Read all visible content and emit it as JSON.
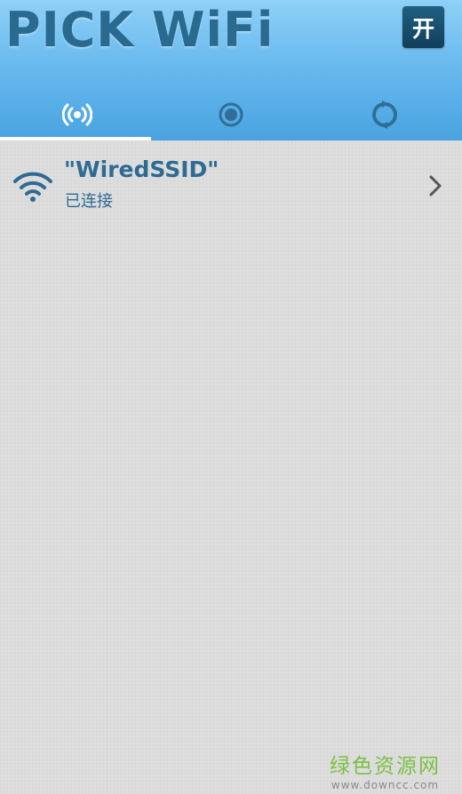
{
  "header": {
    "app_title": "PICK WiFi",
    "toggle_label": "开"
  },
  "tabs": [
    {
      "icon": "broadcast-icon",
      "active": true
    },
    {
      "icon": "radio-target-icon",
      "active": false
    },
    {
      "icon": "refresh-icon",
      "active": false
    }
  ],
  "networks": [
    {
      "ssid": "\"WiredSSID\"",
      "status": "已连接",
      "icon": "wifi-signal-icon"
    }
  ],
  "watermark": {
    "main": "绿色资源网",
    "url": "www.downcc.com"
  },
  "colors": {
    "header_top": "#8fd0f7",
    "header_bottom": "#4aa3e0",
    "title_text": "#2a6a8f",
    "toggle_bg": "#1a4f70",
    "item_text": "#2e6b93",
    "background": "#dcdcdc",
    "watermark_green": "#7bc043"
  }
}
